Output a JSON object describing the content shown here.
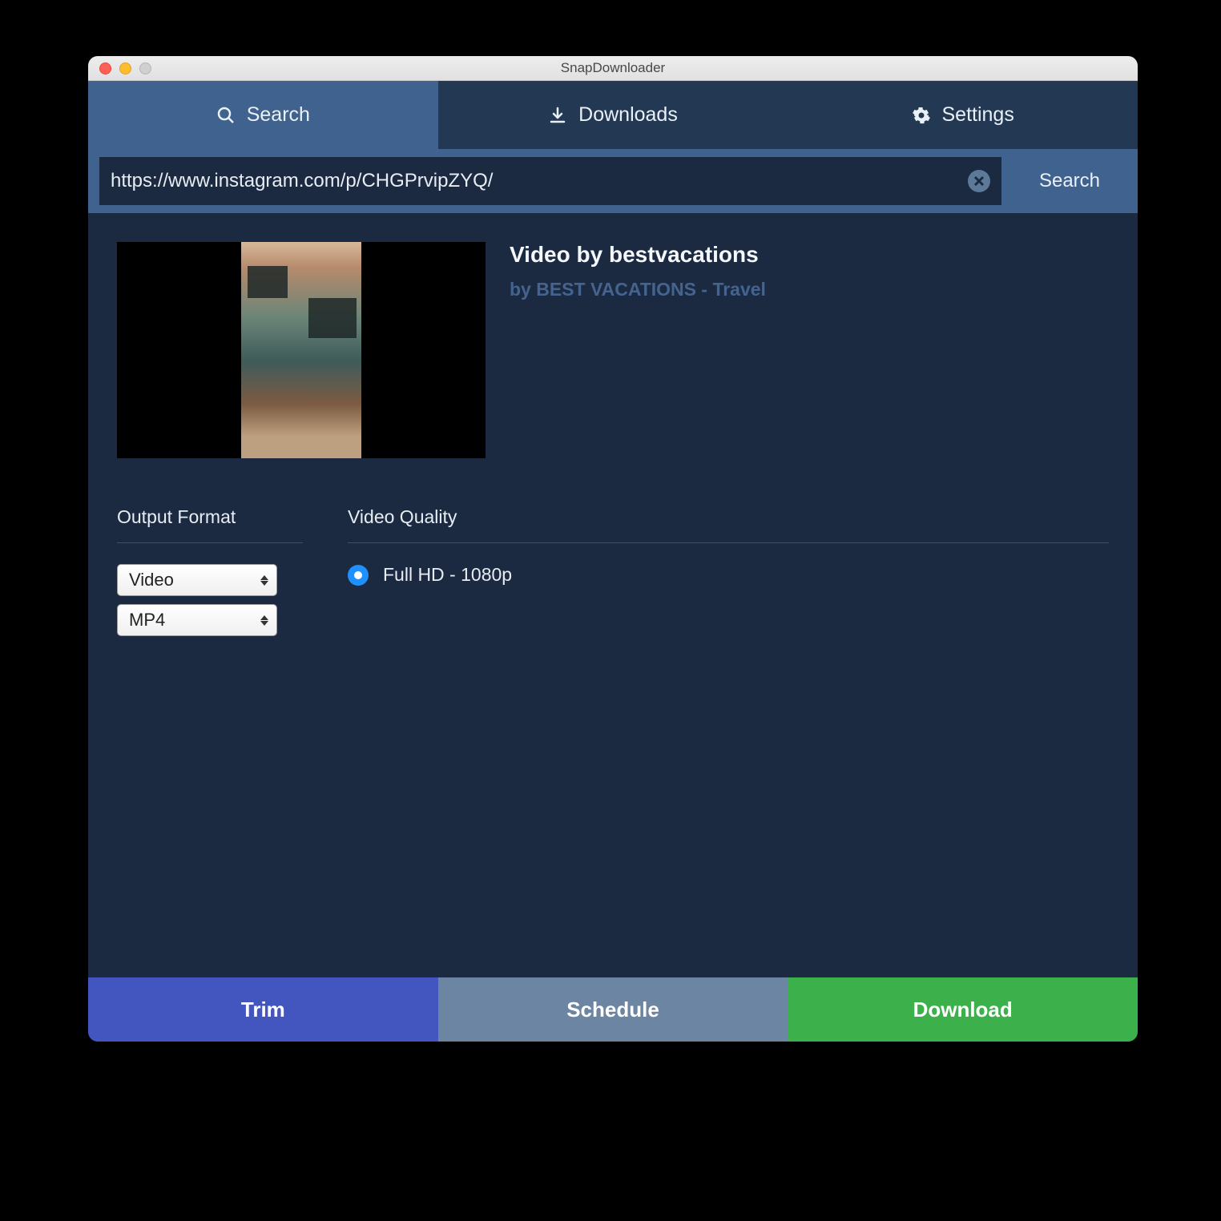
{
  "window": {
    "title": "SnapDownloader"
  },
  "tabs": {
    "search": "Search",
    "downloads": "Downloads",
    "settings": "Settings"
  },
  "search": {
    "url_value": "https://www.instagram.com/p/CHGPrvipZYQ/",
    "search_button": "Search"
  },
  "video": {
    "title": "Video by bestvacations",
    "byline": "by BEST VACATIONS - Travel"
  },
  "options": {
    "output_format_label": "Output Format",
    "video_quality_label": "Video Quality",
    "format_type": "Video",
    "container": "MP4",
    "quality_option": "Full HD - 1080p"
  },
  "actions": {
    "trim": "Trim",
    "schedule": "Schedule",
    "download": "Download"
  }
}
